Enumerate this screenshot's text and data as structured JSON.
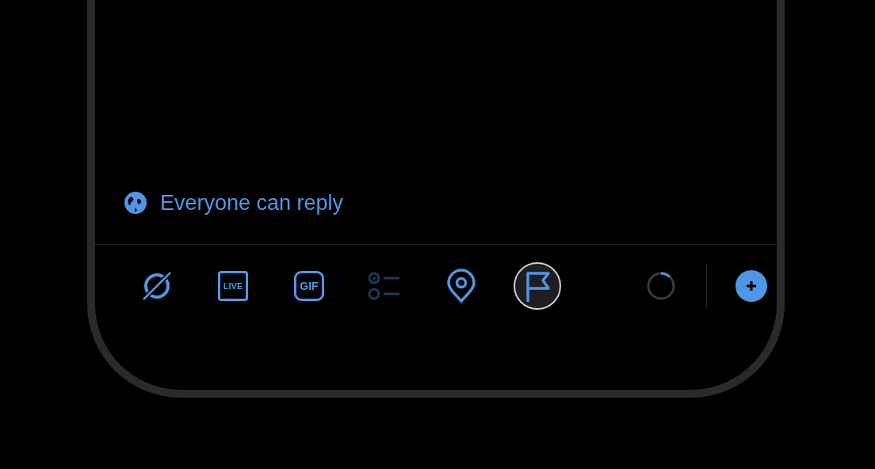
{
  "reply_setting": {
    "label": "Everyone can reply"
  },
  "toolbar": [
    {
      "kind": "media",
      "selected": false,
      "disabled": false
    },
    {
      "kind": "live",
      "label": "LIVE",
      "selected": false,
      "disabled": false
    },
    {
      "kind": "gif",
      "label": "GIF",
      "selected": false,
      "disabled": false
    },
    {
      "kind": "poll",
      "selected": false,
      "disabled": true
    },
    {
      "kind": "location",
      "selected": false,
      "disabled": false
    },
    {
      "kind": "flag",
      "selected": true,
      "disabled": false
    }
  ],
  "char_counter": {
    "level": 0.12
  }
}
